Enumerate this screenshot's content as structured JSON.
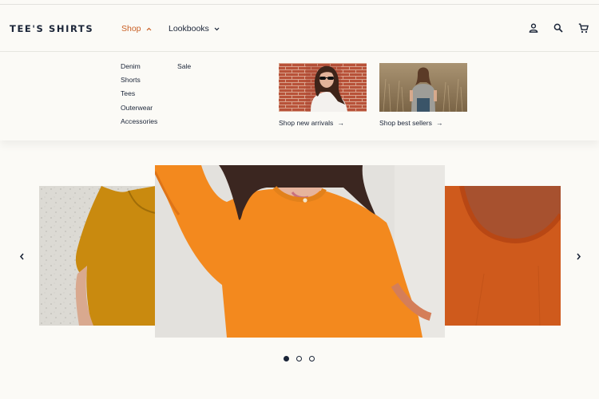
{
  "header": {
    "logo": "TEE'S SHIRTS",
    "nav": [
      {
        "label": "Shop",
        "expanded": true
      },
      {
        "label": "Lookbooks",
        "expanded": false
      }
    ],
    "icons": [
      "account-icon",
      "search-icon",
      "cart-icon"
    ]
  },
  "mega_menu": {
    "column_1": [
      "Denim",
      "Shorts",
      "Tees",
      "Outerwear",
      "Accessories"
    ],
    "column_2": [
      "Sale"
    ],
    "promos": [
      {
        "label": "Shop new arrivals",
        "arrow": "→"
      },
      {
        "label": "Shop best sellers",
        "arrow": "→"
      }
    ]
  },
  "carousel": {
    "slide_count": 3,
    "active_slide": 1
  },
  "colors": {
    "background": "#fbfaf6",
    "accent": "#c95f24",
    "text": "#1b2538"
  }
}
